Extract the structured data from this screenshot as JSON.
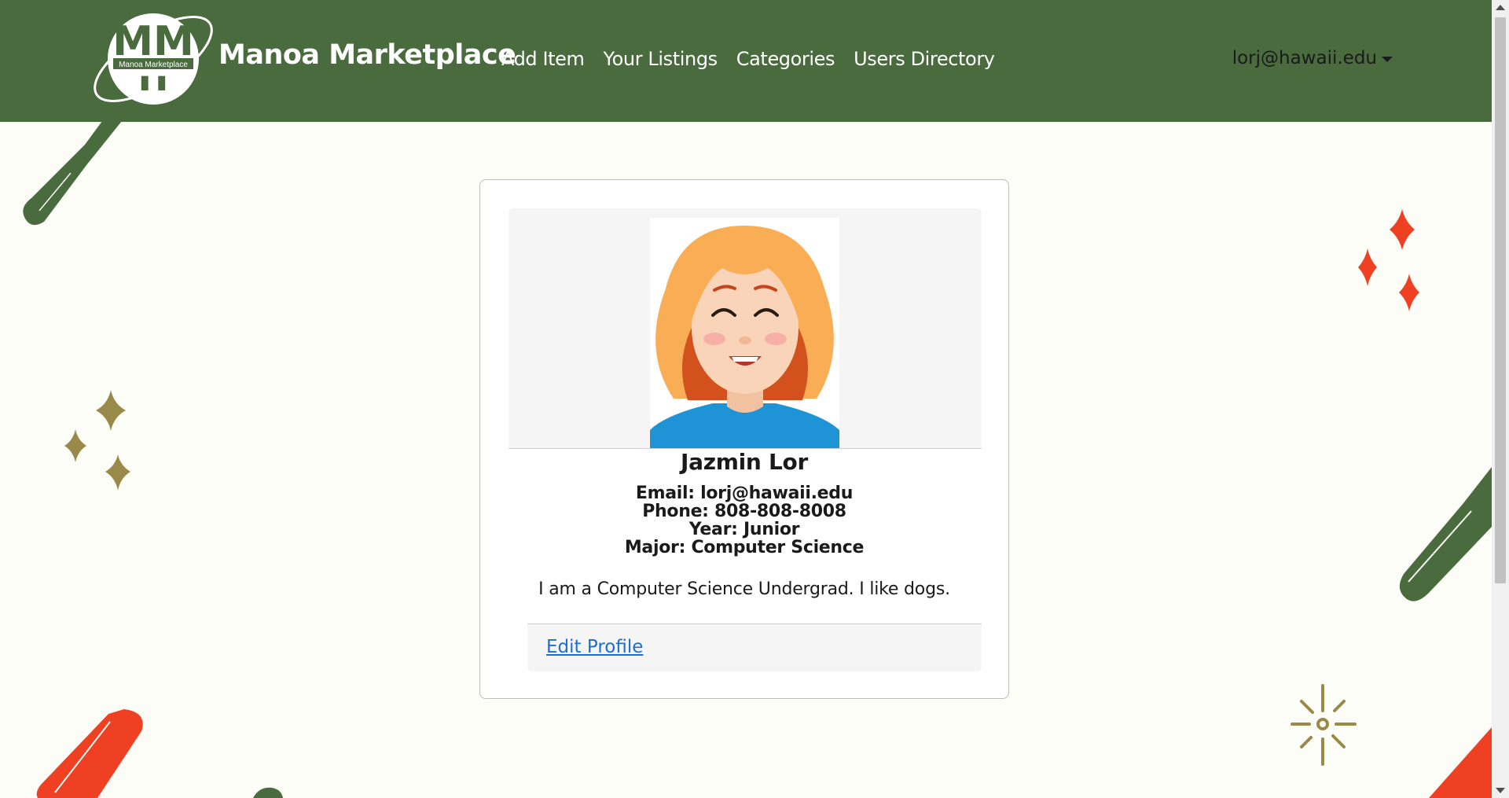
{
  "navbar": {
    "logo_text": "Manoa Marketplace",
    "brand": "Manoa Marketplace",
    "links": [
      "Add Item",
      "Your Listings",
      "Categories",
      "Users Directory"
    ],
    "user": "lorj@hawaii.edu"
  },
  "profile": {
    "name": "Jazmin Lor",
    "email": "Email: lorj@hawaii.edu",
    "phone": "Phone: 808-808-8008",
    "year": "Year: Junior",
    "major": "Major: Computer Science",
    "bio": "I am a Computer Science Undergrad. I like dogs.",
    "edit_label": "Edit Profile"
  },
  "colors": {
    "navbar": "#4a6b3e",
    "background": "#fdfdf8",
    "link": "#1a6fd6",
    "accent_red": "#f04023",
    "accent_olive": "#9a8a4a"
  }
}
